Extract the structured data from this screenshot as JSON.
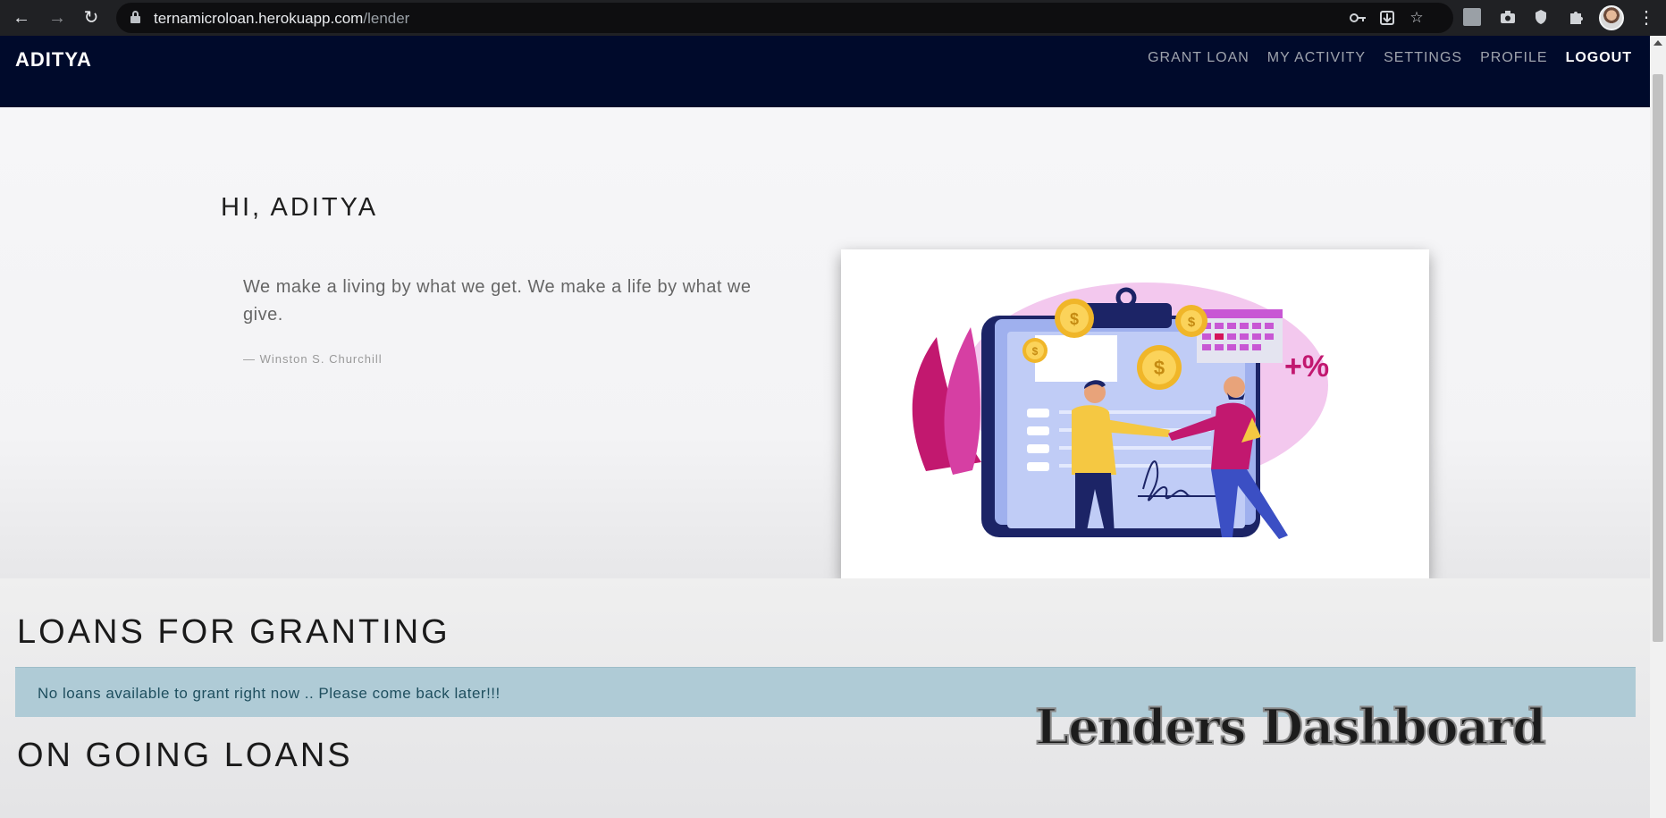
{
  "browser": {
    "url_host": "ternamicroloan.herokuapp.com",
    "url_path": "/lender",
    "icons": {
      "back": "arrow-left-icon",
      "forward": "arrow-right-icon",
      "reload": "reload-icon",
      "lock": "lock-icon",
      "key": "key-icon",
      "install": "install-icon",
      "bookmark": "star-icon",
      "extensions": "puzzle-icon",
      "menu": "kebab-menu-icon"
    }
  },
  "navbar": {
    "brand": "ADITYA",
    "links": [
      "GRANT LOAN",
      "MY ACTIVITY",
      "SETTINGS",
      "PROFILE",
      "LOGOUT"
    ],
    "background": "#000a2b"
  },
  "hero": {
    "greeting": "HI, ADITYA",
    "quote": "We make a living by what we get. We make a life by what we give.",
    "citation": "— Winston S. Churchill",
    "illustration_icon": "loan-handshake-illustration",
    "illustration_text": "+%"
  },
  "sections": {
    "loans_for_granting": "LOANS FOR GRANTING",
    "no_loans_message": "No loans available to grant right now .. Please come back later!!!",
    "ongoing_loans": "ON GOING LOANS"
  },
  "overlay_caption": "Lenders Dashboard"
}
